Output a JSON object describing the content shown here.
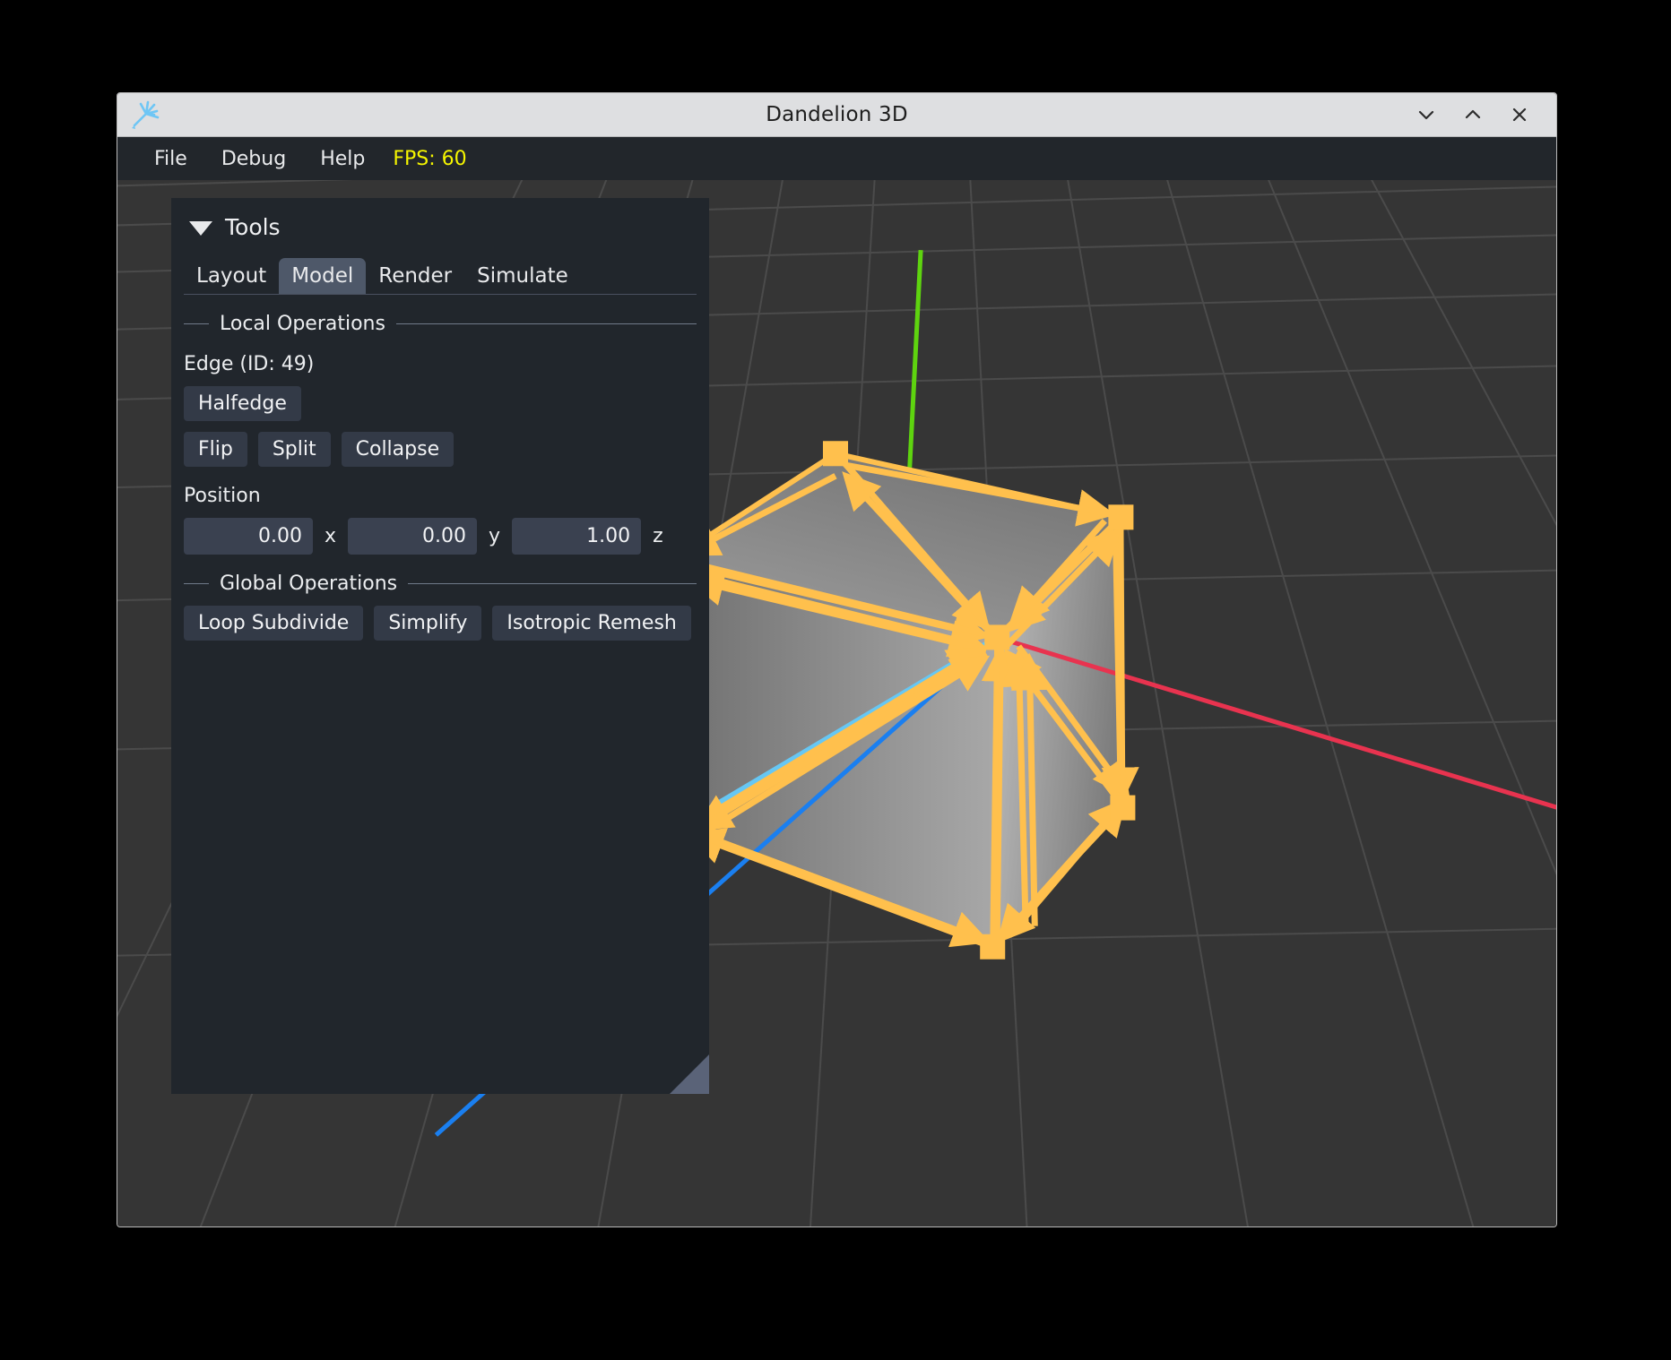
{
  "window": {
    "title": "Dandelion 3D",
    "app_icon": "dandelion-icon",
    "controls": [
      {
        "name": "minimize-button",
        "icon": "chevron-down-icon"
      },
      {
        "name": "maximize-button",
        "icon": "chevron-up-icon"
      },
      {
        "name": "close-button",
        "icon": "close-icon"
      }
    ]
  },
  "menubar": {
    "items": [
      {
        "label": "File"
      },
      {
        "label": "Debug"
      },
      {
        "label": "Help"
      }
    ],
    "fps_label": "FPS: 60",
    "fps_color": "#f5f500"
  },
  "panel": {
    "title": "Tools",
    "collapse_icon": "caret-down-icon",
    "tabs": [
      {
        "label": "Layout",
        "active": false
      },
      {
        "label": "Model",
        "active": true
      },
      {
        "label": "Render",
        "active": false
      },
      {
        "label": "Simulate",
        "active": false
      }
    ],
    "local_operations": {
      "section_label": "Local Operations",
      "selection_label": "Edge (ID: 49)",
      "halfedge_button": "Halfedge",
      "edge_buttons": [
        "Flip",
        "Split",
        "Collapse"
      ],
      "position_label": "Position",
      "position": [
        {
          "value": "0.00",
          "axis": "x"
        },
        {
          "value": "0.00",
          "axis": "y"
        },
        {
          "value": "1.00",
          "axis": "z"
        }
      ]
    },
    "global_operations": {
      "section_label": "Global Operations",
      "buttons": [
        "Loop Subdivide",
        "Simplify",
        "Isotropic Remesh"
      ]
    },
    "resize_grip": "resize-grip-icon"
  },
  "viewport": {
    "background_color": "#353535",
    "grid_color": "#4b4b4b",
    "mesh_name": "cube-mesh",
    "mesh_fill_light": "#b9b9b9",
    "mesh_fill_dark": "#6e6e6e",
    "halfedge_color": "#ffc04d",
    "axes": [
      {
        "name": "y-axis",
        "color": "#5ed40f"
      },
      {
        "name": "x-axis",
        "color": "#e8334f"
      },
      {
        "name": "z-axis",
        "color": "#1a7ff0"
      },
      {
        "name": "selected-edge",
        "color": "#66c7f4"
      }
    ]
  }
}
